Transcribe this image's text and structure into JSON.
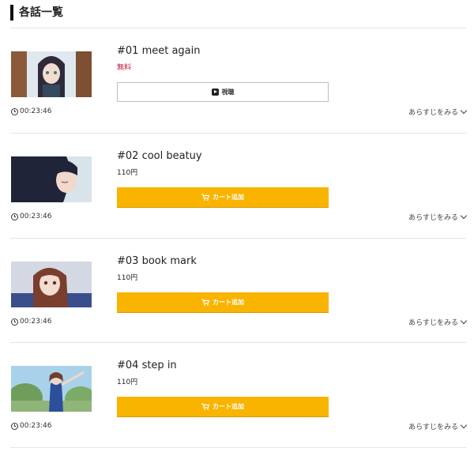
{
  "section": {
    "title": "各話一覧"
  },
  "episodes": [
    {
      "title": "#01 meet again",
      "price": "無料",
      "free": true,
      "button": "視聴",
      "duration": "00:23:46",
      "synopsis": "あらすじをみる"
    },
    {
      "title": "#02 cool beatuy",
      "price": "110円",
      "free": false,
      "button": "カート追加",
      "duration": "00:23:46",
      "synopsis": "あらすじをみる"
    },
    {
      "title": "#03 book mark",
      "price": "110円",
      "free": false,
      "button": "カート追加",
      "duration": "00:23:46",
      "synopsis": "あらすじをみる"
    },
    {
      "title": "#04 step in",
      "price": "110円",
      "free": false,
      "button": "カート追加",
      "duration": "00:23:46",
      "synopsis": "あらすじをみる"
    }
  ],
  "colors": {
    "cart_button": "#f9b400",
    "free_price": "#c8102e"
  },
  "icons": [
    "clock-icon",
    "play-icon",
    "cart-icon",
    "chevron-down-icon"
  ]
}
